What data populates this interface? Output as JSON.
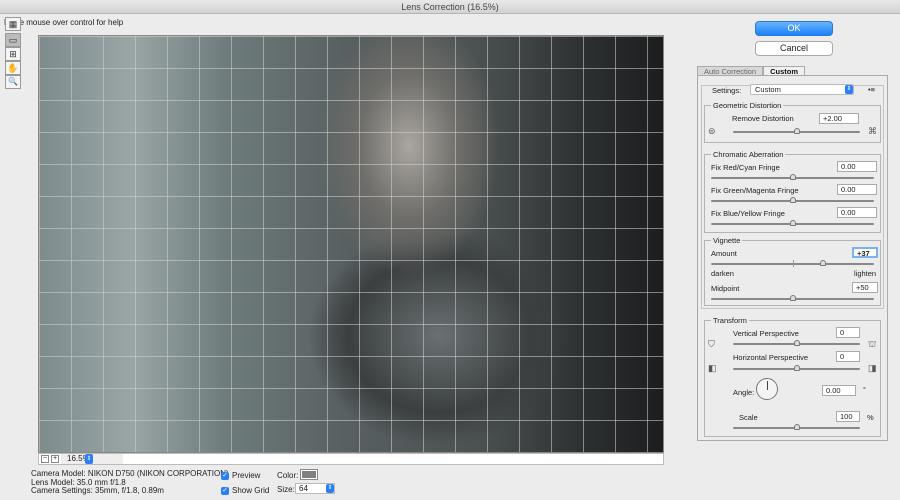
{
  "window": {
    "title": "Lens Correction (16.5%)"
  },
  "help_text": "Place mouse over control for help",
  "tools": [
    {
      "icon": "remove-distortion-icon",
      "glyph": "▦"
    },
    {
      "icon": "straighten-icon",
      "glyph": "▭"
    },
    {
      "icon": "move-grid-icon",
      "glyph": "⊞"
    },
    {
      "icon": "hand-icon",
      "glyph": "✋"
    },
    {
      "icon": "zoom-icon",
      "glyph": "🔍"
    }
  ],
  "zoom": {
    "minus": "−",
    "plus": "+",
    "value": "16.5%"
  },
  "buttons": {
    "ok": "OK",
    "cancel": "Cancel"
  },
  "tabs": [
    {
      "label": "Auto Correction",
      "active": false
    },
    {
      "label": "Custom",
      "active": true
    }
  ],
  "settings": {
    "label": "Settings:",
    "value": "Custom",
    "menu_glyph": "•≡"
  },
  "geometric": {
    "title": "Geometric Distortion",
    "label": "Remove Distortion",
    "value": "+2.00",
    "slider": 0.5
  },
  "chromatic": {
    "title": "Chromatic Aberration",
    "items": [
      {
        "label": "Fix Red/Cyan Fringe",
        "value": "0.00",
        "slider": 0.5
      },
      {
        "label": "Fix Green/Magenta Fringe",
        "value": "0.00",
        "slider": 0.5
      },
      {
        "label": "Fix Blue/Yellow Fringe",
        "value": "0.00",
        "slider": 0.5
      }
    ]
  },
  "vignette": {
    "title": "Vignette",
    "amount_label": "Amount",
    "amount": "+37",
    "amount_slider": 0.685,
    "darken": "darken",
    "lighten": "lighten",
    "midpoint_label": "Midpoint",
    "midpoint": "+50",
    "midpoint_slider": 0.5
  },
  "transform": {
    "title": "Transform",
    "vertical_label": "Vertical Perspective",
    "vertical": "0",
    "horizontal_label": "Horizontal Perspective",
    "horizontal": "0",
    "angle_label": "Angle:",
    "angle": "0.00",
    "angle_unit": "°",
    "scale_label": "Scale",
    "scale": "100",
    "scale_unit": "%"
  },
  "info": {
    "camera_model": "Camera Model: NIKON D750 (NIKON CORPORATION)",
    "lens_model": "Lens Model: 35.0 mm f/1.8",
    "camera_settings": "Camera Settings: 35mm, f/1.8, 0.89m"
  },
  "options": {
    "preview": "Preview",
    "preview_checked": true,
    "show_grid": "Show Grid",
    "show_grid_checked": true,
    "color_label": "Color:",
    "grid_color": "#808080",
    "size_label": "Size:",
    "size": "64"
  }
}
